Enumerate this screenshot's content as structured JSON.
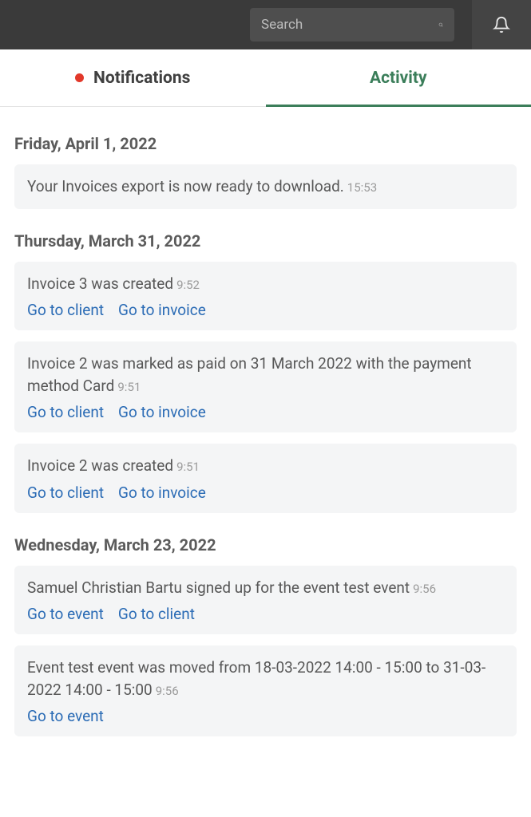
{
  "header": {
    "search_placeholder": "Search"
  },
  "tabs": {
    "notifications": "Notifications",
    "activity": "Activity"
  },
  "days": [
    {
      "heading": "Friday, April 1, 2022",
      "items": [
        {
          "message": "Your Invoices export is now ready to download.",
          "time": "15:53",
          "links": []
        }
      ]
    },
    {
      "heading": "Thursday, March 31, 2022",
      "items": [
        {
          "message": "Invoice 3 was created",
          "time": "9:52",
          "links": [
            "Go to client",
            "Go to invoice"
          ]
        },
        {
          "message": "Invoice 2 was marked as paid on 31 March 2022 with the payment method Card",
          "time": "9:51",
          "links": [
            "Go to client",
            "Go to invoice"
          ]
        },
        {
          "message": "Invoice 2 was created",
          "time": "9:51",
          "links": [
            "Go to client",
            "Go to invoice"
          ]
        }
      ]
    },
    {
      "heading": "Wednesday, March 23, 2022",
      "items": [
        {
          "message": "Samuel Christian Bartu signed up for the event test event",
          "time": "9:56",
          "links": [
            "Go to event",
            "Go to client"
          ]
        },
        {
          "message": "Event test event was moved from 18-03-2022 14:00 - 15:00 to 31-03-2022 14:00 - 15:00",
          "time": "9:56",
          "links": [
            "Go to event"
          ]
        }
      ]
    }
  ]
}
